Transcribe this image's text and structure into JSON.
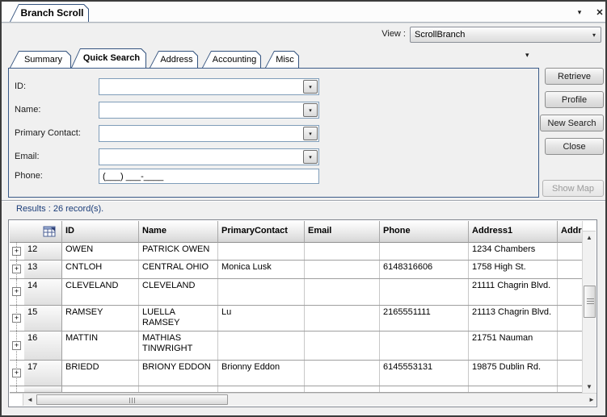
{
  "window": {
    "title_tab": "Branch Scroll"
  },
  "icons": {
    "chevron_down": "▾",
    "close": "✕",
    "combo_arrow": "▼",
    "scroll_up": "▲",
    "scroll_down": "▼",
    "scroll_left": "◄",
    "scroll_right": "►",
    "expand": "+"
  },
  "colors": {
    "accent_border": "#33527e",
    "results_text": "#1a3c78",
    "disabled_text": "#9b9b9b"
  },
  "view": {
    "label": "View :",
    "value": "ScrollBranch"
  },
  "tabs": [
    {
      "label": "Summary"
    },
    {
      "label": "Quick Search"
    },
    {
      "label": "Address"
    },
    {
      "label": "Accounting"
    },
    {
      "label": "Misc"
    }
  ],
  "search": {
    "fields": [
      {
        "label": "ID:",
        "value": ""
      },
      {
        "label": "Name:",
        "value": ""
      },
      {
        "label": "Primary Contact:",
        "value": ""
      },
      {
        "label": "Email:",
        "value": ""
      },
      {
        "label": "Phone:",
        "value": "(___) ___-____"
      }
    ]
  },
  "buttons": {
    "retrieve": "Retrieve",
    "profile": "Profile",
    "new_search": "New Search",
    "close": "Close",
    "show_map": "Show Map"
  },
  "results": {
    "label": "Results : 26 record(s)."
  },
  "grid": {
    "columns": [
      "ID",
      "Name",
      "PrimaryContact",
      "Email",
      "Phone",
      "Address1",
      "Addres"
    ],
    "rows": [
      {
        "num": "12",
        "id": "OWEN",
        "name": "PATRICK OWEN",
        "contact": "",
        "email": "",
        "phone": "",
        "address1": "1234 Chambers",
        "address2": ""
      },
      {
        "num": "13",
        "id": "CNTLOH",
        "name": "CENTRAL OHIO",
        "contact": "Monica Lusk",
        "email": "",
        "phone": "6148316606",
        "address1": "1758 High St.",
        "address2": ""
      },
      {
        "num": "14",
        "id": "CLEVELAND",
        "name": "CLEVELAND",
        "contact": "",
        "email": "",
        "phone": "",
        "address1": "21111 Chagrin Blvd.",
        "address2": ""
      },
      {
        "num": "15",
        "id": "RAMSEY",
        "name": "LUELLA RAMSEY",
        "contact": "Lu",
        "email": "",
        "phone": "2165551111",
        "address1": "21113 Chagrin Blvd.",
        "address2": ""
      },
      {
        "num": "16",
        "id": "MATTIN",
        "name": "MATHIAS TINWRIGHT",
        "contact": "",
        "email": "",
        "phone": "",
        "address1": "21751 Nauman",
        "address2": ""
      },
      {
        "num": "17",
        "id": "BRIEDD",
        "name": "BRIONY EDDON",
        "contact": "Brionny Eddon",
        "email": "",
        "phone": "6145553131",
        "address1": "19875 Dublin Rd.",
        "address2": ""
      }
    ]
  }
}
